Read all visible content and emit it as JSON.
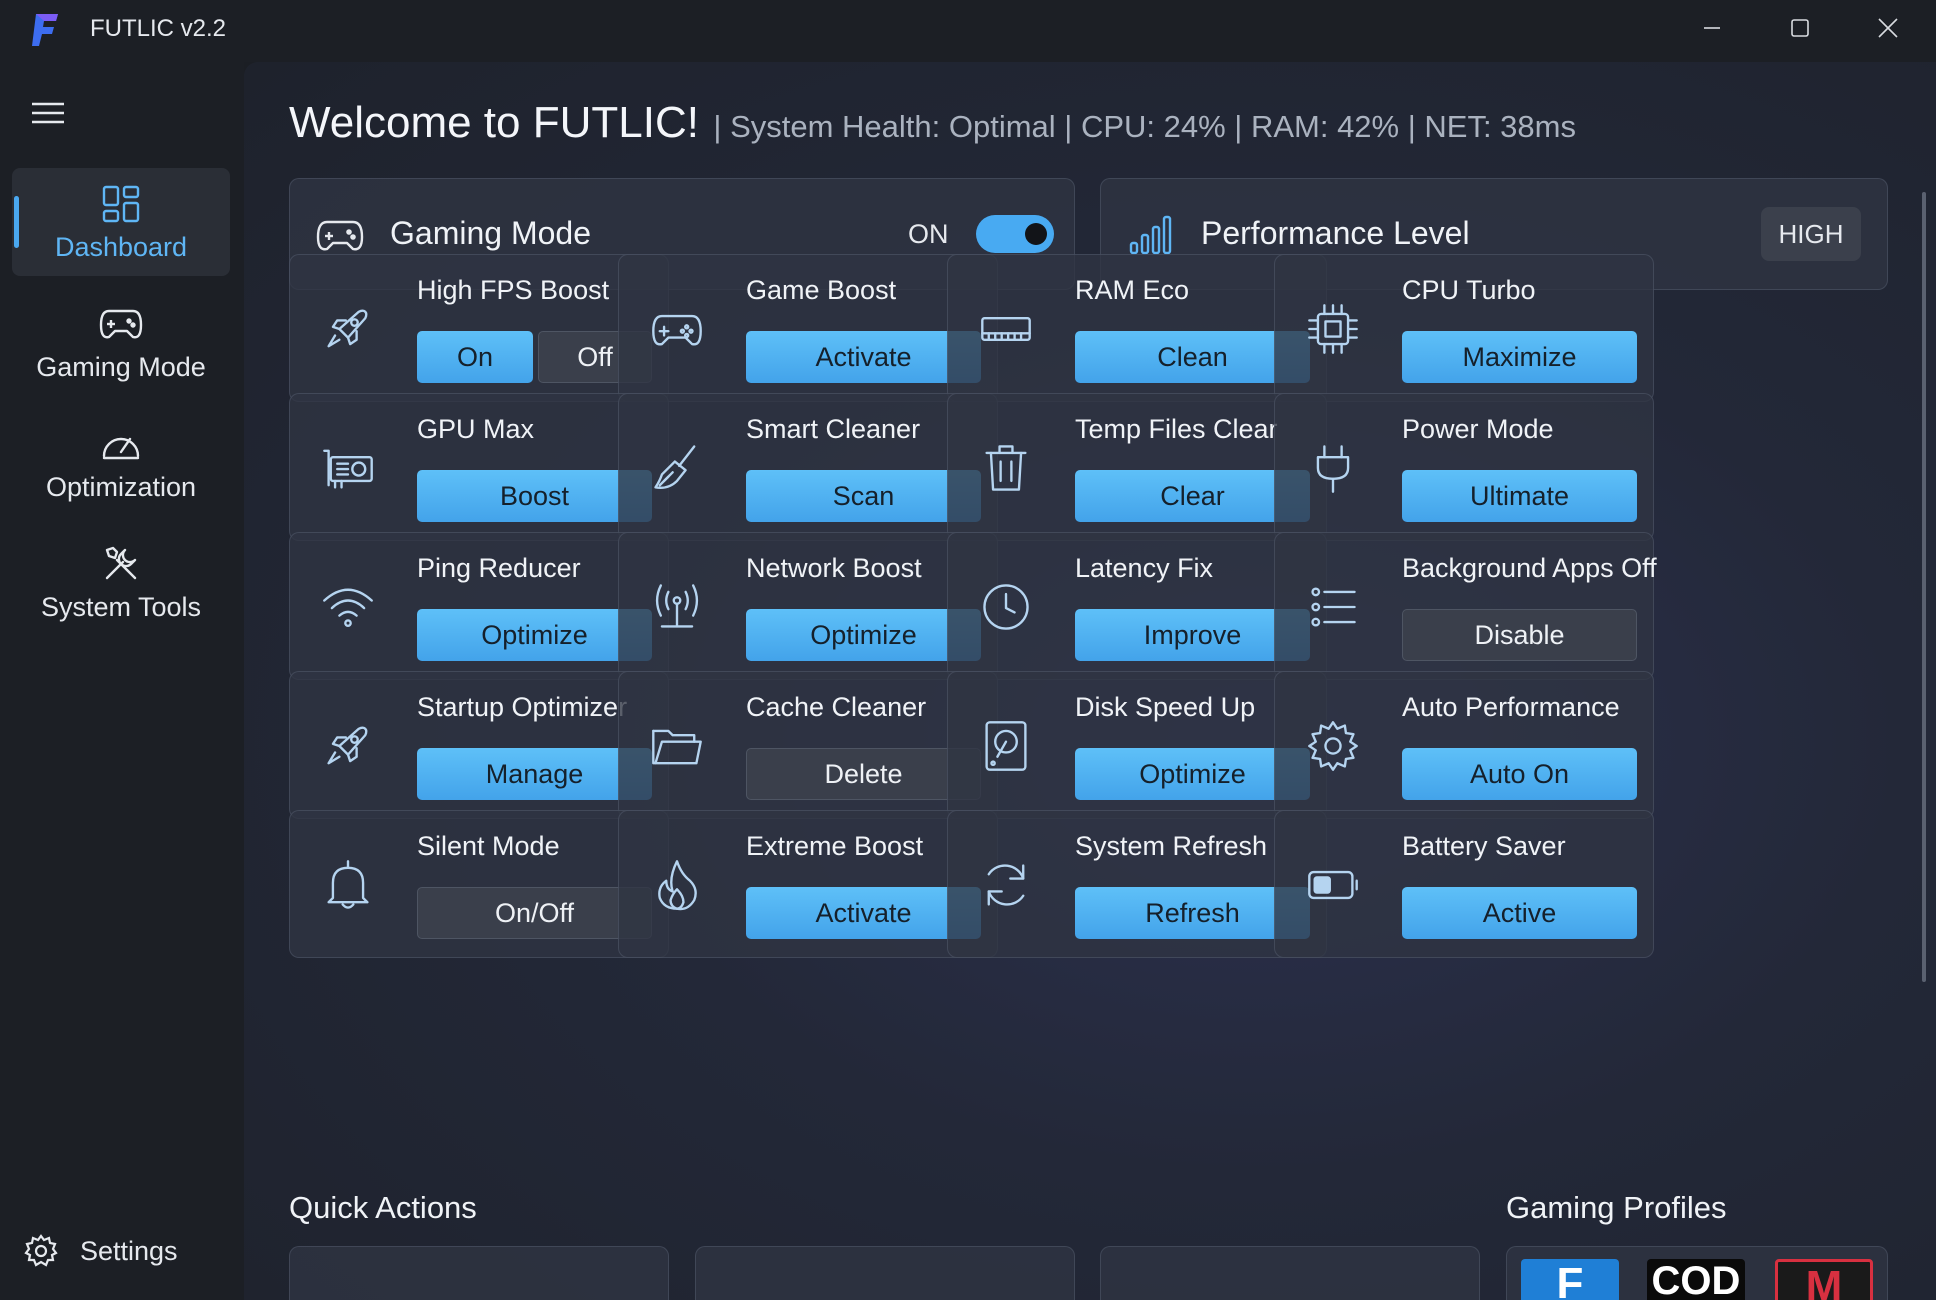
{
  "window": {
    "title": "FUTLIC v2.2",
    "minimize_icon": "minimize-icon",
    "maximize_icon": "maximize-icon",
    "close_icon": "close-icon"
  },
  "sidebar": {
    "menu_icon": "hamburger-menu-icon",
    "items": [
      {
        "label": "Dashboard",
        "icon": "dashboard-grid-icon",
        "active": true
      },
      {
        "label": "Gaming Mode",
        "icon": "gamepad-icon",
        "active": false
      },
      {
        "label": "Optimization",
        "icon": "speedometer-icon",
        "active": false
      },
      {
        "label": "System Tools",
        "icon": "tools-icon",
        "active": false
      }
    ],
    "settings": {
      "label": "Settings",
      "icon": "gear-icon"
    }
  },
  "header": {
    "welcome": "Welcome to FUTLIC!",
    "status": "| System Health: Optimal | CPU: 24% | RAM: 42% | NET: 38ms"
  },
  "gaming_mode": {
    "title": "Gaming Mode",
    "state_label": "ON",
    "enabled": true,
    "icon": "gamepad-icon"
  },
  "performance": {
    "title": "Performance Level",
    "level": "HIGH",
    "icon": "bar-chart-icon"
  },
  "cards": [
    {
      "title": "High FPS Boost",
      "icon": "rocket-icon",
      "buttons": [
        "On",
        "Off"
      ]
    },
    {
      "title": "Game Boost",
      "icon": "gamepad-icon",
      "button": "Activate",
      "style": "primary"
    },
    {
      "title": "RAM Eco",
      "icon": "ram-icon",
      "button": "Clean",
      "style": "primary"
    },
    {
      "title": "CPU Turbo",
      "icon": "cpu-chip-icon",
      "button": "Maximize",
      "style": "primary"
    },
    {
      "title": "GPU Max",
      "icon": "gpu-icon",
      "button": "Boost",
      "style": "primary"
    },
    {
      "title": "Smart Cleaner",
      "icon": "broom-icon",
      "button": "Scan",
      "style": "primary"
    },
    {
      "title": "Temp Files Clear",
      "icon": "trash-icon",
      "button": "Clear",
      "style": "primary"
    },
    {
      "title": "Power Mode",
      "icon": "plug-icon",
      "button": "Ultimate",
      "style": "primary"
    },
    {
      "title": "Ping Reducer",
      "icon": "wifi-icon",
      "button": "Optimize",
      "style": "primary"
    },
    {
      "title": "Network Boost",
      "icon": "antenna-icon",
      "button": "Optimize",
      "style": "primary"
    },
    {
      "title": "Latency Fix",
      "icon": "clock-icon",
      "button": "Improve",
      "style": "primary"
    },
    {
      "title": "Background Apps Off",
      "icon": "list-icon",
      "button": "Disable",
      "style": "secondary"
    },
    {
      "title": "Startup Optimizer",
      "icon": "rocket-icon",
      "button": "Manage",
      "style": "primary"
    },
    {
      "title": "Cache Cleaner",
      "icon": "folder-icon",
      "button": "Delete",
      "style": "secondary"
    },
    {
      "title": "Disk Speed Up",
      "icon": "hard-disk-icon",
      "button": "Optimize",
      "style": "primary"
    },
    {
      "title": "Auto Performance",
      "icon": "gear-icon",
      "button": "Auto On",
      "style": "primary"
    },
    {
      "title": "Silent Mode",
      "icon": "bell-icon",
      "button": "On/Off",
      "style": "secondary"
    },
    {
      "title": "Extreme Boost",
      "icon": "flame-icon",
      "button": "Activate",
      "style": "primary"
    },
    {
      "title": "System Refresh",
      "icon": "refresh-icon",
      "button": "Refresh",
      "style": "primary"
    },
    {
      "title": "Battery Saver",
      "icon": "battery-icon",
      "button": "Active",
      "style": "primary"
    }
  ],
  "quick_actions": {
    "title": "Quick Actions"
  },
  "gaming_profiles": {
    "title": "Gaming Profiles",
    "tiles": [
      {
        "label": "F",
        "color": "#1f7fd6"
      },
      {
        "label": "COD",
        "color": "#0a0a0a"
      },
      {
        "label": "M",
        "color": "#d83040"
      }
    ]
  },
  "colors": {
    "accent": "#4aa8f0",
    "button_primary": "#55b7f5"
  }
}
